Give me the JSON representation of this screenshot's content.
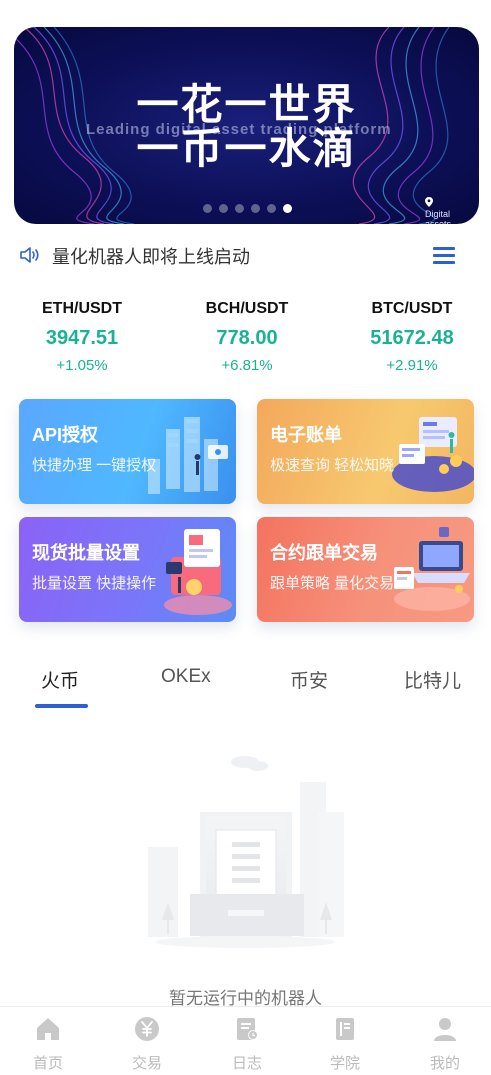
{
  "banner": {
    "title_line1": "一花一世界",
    "title_line2": "一币一水滴",
    "subtitle": "Leading digital asset trading platform",
    "tag": "Digital assets",
    "dots": 6,
    "active_dot": 5
  },
  "notice": {
    "text": "量化机器人即将上线启动"
  },
  "tickers": [
    {
      "pair": "ETH/USDT",
      "price": "3947.51",
      "change": "+1.05%"
    },
    {
      "pair": "BCH/USDT",
      "price": "778.00",
      "change": "+6.81%"
    },
    {
      "pair": "BTC/USDT",
      "price": "51672.48",
      "change": "+2.91%"
    }
  ],
  "cards": {
    "api": {
      "title": "API授权",
      "subtitle": "快捷办理 一键授权"
    },
    "bill": {
      "title": "电子账单",
      "subtitle": "极速查询 轻松知晓"
    },
    "spot": {
      "title": "现货批量设置",
      "subtitle": "批量设置 快捷操作"
    },
    "copy": {
      "title": "合约跟单交易",
      "subtitle": "跟单策略 量化交易"
    }
  },
  "tabs": [
    {
      "label": "火币"
    },
    {
      "label": "OKEx"
    },
    {
      "label": "币安"
    },
    {
      "label": "比特儿"
    }
  ],
  "empty_state": {
    "text": "暂无运行中的机器人"
  },
  "bottom_nav": [
    {
      "label": "首页",
      "icon": "home-icon"
    },
    {
      "label": "交易",
      "icon": "yen-coin-icon"
    },
    {
      "label": "日志",
      "icon": "log-icon"
    },
    {
      "label": "学院",
      "icon": "book-icon"
    },
    {
      "label": "我的",
      "icon": "user-icon"
    }
  ],
  "colors": {
    "accent": "#2d5fd6",
    "up": "#19b394",
    "banner_bg": "#0c0f55"
  }
}
